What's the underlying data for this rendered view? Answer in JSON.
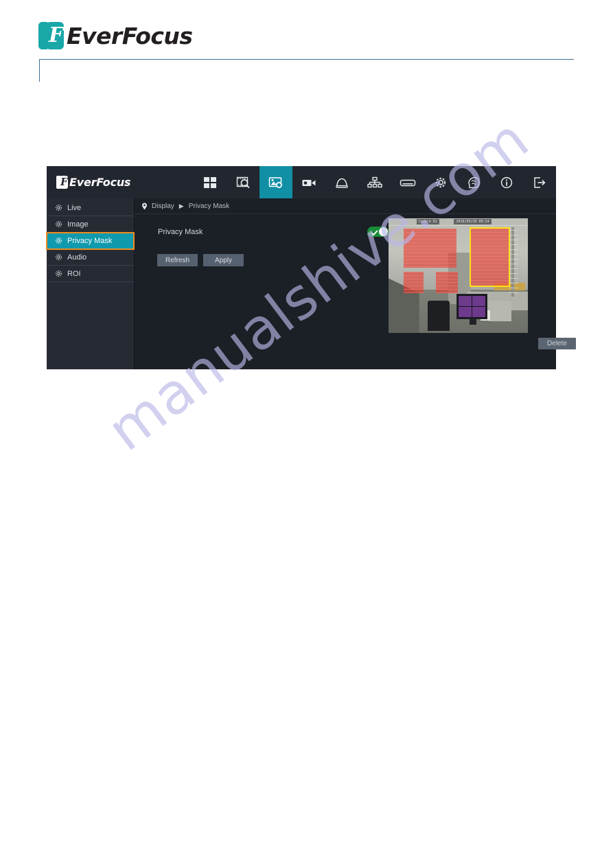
{
  "document": {
    "brand": "EverFocus",
    "logo_letter": "F",
    "watermark": "manualshive.com"
  },
  "device": {
    "navbar": {
      "brand": "EverFocus",
      "logo_letter": "F",
      "items": [
        {
          "name": "layout-grid-icon",
          "label": "Live View",
          "active": false
        },
        {
          "name": "playback-search-icon",
          "label": "Playback",
          "active": false
        },
        {
          "name": "image-settings-icon",
          "label": "Display",
          "active": true
        },
        {
          "name": "video-camera-icon",
          "label": "Video",
          "active": false
        },
        {
          "name": "alarm-bell-icon",
          "label": "Event",
          "active": false
        },
        {
          "name": "network-tree-icon",
          "label": "Network",
          "active": false
        },
        {
          "name": "storage-disk-icon",
          "label": "Storage",
          "active": false
        },
        {
          "name": "gear-icon",
          "label": "System",
          "active": false
        },
        {
          "name": "ai-face-icon",
          "label": "AI",
          "active": false
        },
        {
          "name": "info-circle-icon",
          "label": "Information",
          "active": false
        },
        {
          "name": "logout-icon",
          "label": "Logout",
          "active": false
        }
      ]
    },
    "sidebar": {
      "items": [
        {
          "label": "Live",
          "selected": false
        },
        {
          "label": "Image",
          "selected": false
        },
        {
          "label": "Privacy Mask",
          "selected": true
        },
        {
          "label": "Audio",
          "selected": false
        },
        {
          "label": "ROI",
          "selected": false
        }
      ]
    },
    "breadcrumb": {
      "root": "Display",
      "separator": "▶",
      "current": "Privacy Mask"
    },
    "panel": {
      "privacy_mask_label": "Privacy Mask",
      "privacy_mask_enabled": "on",
      "refresh_label": "Refresh",
      "apply_label": "Apply",
      "delete_label": "Delete"
    },
    "preview": {
      "osd_camera_name": "Camera 01",
      "osd_timestamp": "2018/03/20 09:14",
      "mask_count": 4,
      "selected_mask_index": 4
    },
    "colors": {
      "accent_teal": "#119aad",
      "selected_outline": "#f08a1d",
      "toggle_on": "#1a8c38",
      "mask_red": "#e83c30",
      "mask_selected_border": "#ffe01b",
      "panel_bg": "#1b1f26",
      "sidebar_bg": "#262b33",
      "navbar_bg": "#22262e",
      "button_bg": "#566170"
    }
  }
}
